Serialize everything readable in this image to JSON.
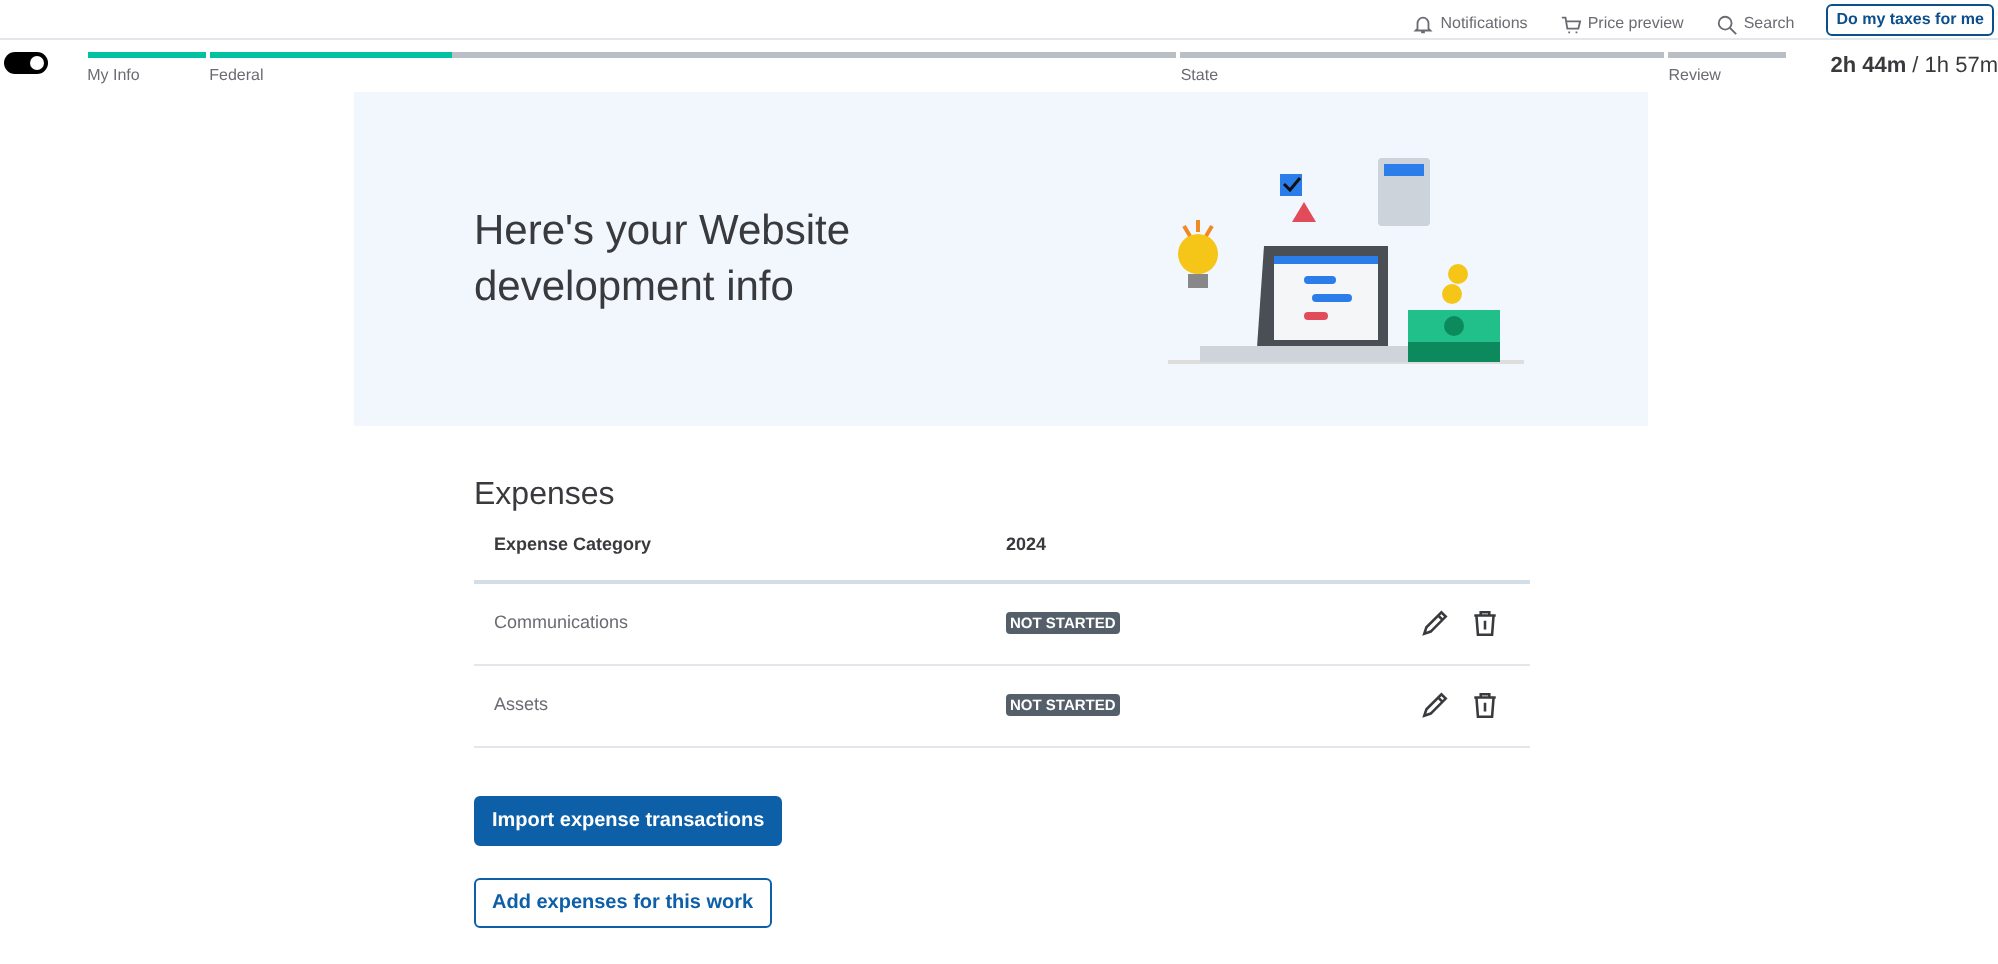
{
  "top_nav": {
    "links": [
      {
        "label": "Notifications"
      },
      {
        "label": "Price preview"
      },
      {
        "label": "Search"
      }
    ],
    "button": "Do my taxes for me"
  },
  "toggle": {
    "on": true
  },
  "progress": {
    "steps": [
      {
        "label": "My Info",
        "level": 1
      },
      {
        "label": "Federal",
        "level": 0.25
      },
      {
        "label": "State",
        "level": 0
      },
      {
        "label": "Review",
        "level": 0
      }
    ],
    "time_spent": "2h 44m",
    "time_separator": "/",
    "time_estimate": "1h 57m"
  },
  "hero": {
    "title": "Here's your Website development info"
  },
  "expenses": {
    "heading": "Expenses",
    "columns": [
      "Expense Category",
      "2024"
    ],
    "rows": [
      {
        "category": "Communications",
        "status": "NOT STARTED"
      },
      {
        "category": "Assets",
        "status": "NOT STARTED"
      }
    ]
  },
  "buttons": [
    {
      "label": "Import expense transactions",
      "kind": "primary"
    },
    {
      "label": "Add expenses for this work",
      "kind": "outline"
    }
  ]
}
